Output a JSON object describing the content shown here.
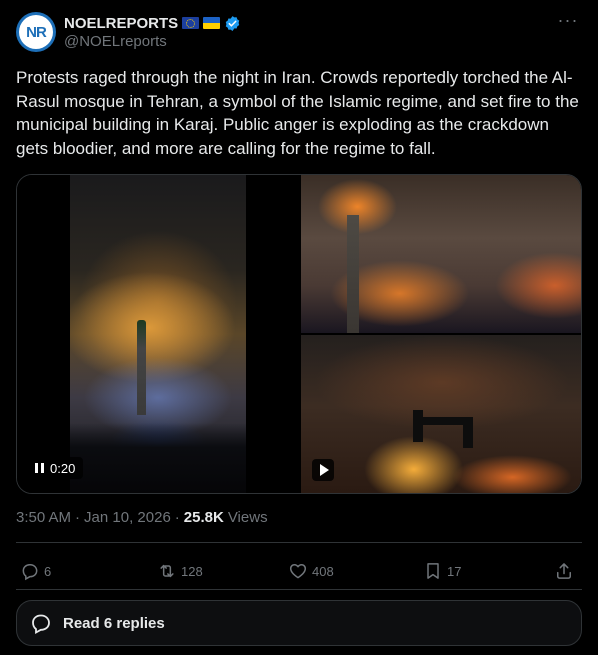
{
  "author": {
    "display_name": "NOELREPORTS",
    "handle": "@NOELreports",
    "avatar_text": "NR",
    "flags": [
      "eu-flag",
      "ukraine-flag"
    ],
    "verified": true
  },
  "more_label": "···",
  "tweet": {
    "text": "Protests raged through the night in Iran. Crowds reportedly torched the Al-Rasul mosque in Tehran, a symbol of the Islamic regime, and set fire to the municipal building in Karaj. Public anger is exploding as the crackdown gets bloodier, and more are calling for the regime to fall."
  },
  "media": {
    "video_time": "0:20"
  },
  "meta": {
    "time": "3:50 AM",
    "dot1": "·",
    "date": "Jan 10, 2026",
    "dot2": "·",
    "views_count": "25.8K",
    "views_label": "Views"
  },
  "actions": {
    "replies": "6",
    "reposts": "128",
    "likes": "408",
    "bookmarks": "17"
  },
  "read_replies_label": "Read 6 replies",
  "colors": {
    "background": "#000000",
    "text": "#e7e9ea",
    "muted": "#71767b",
    "border": "#2f3336",
    "verified": "#1d9bf0"
  }
}
